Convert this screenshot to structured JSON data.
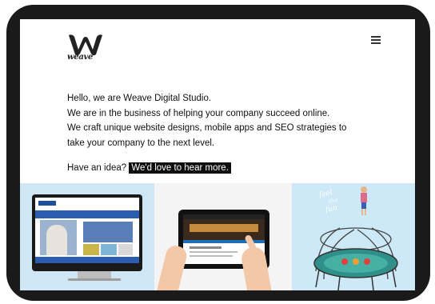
{
  "brand": {
    "name": "weave",
    "logo_icon": "weave-w-logo",
    "accent": "#1a1a1a"
  },
  "header": {
    "menu_icon": "hamburger-icon"
  },
  "intro": {
    "line1": "Hello, we are Weave Digital Studio.",
    "line2": "We are in the business of helping your company succeed online.",
    "line3": "We craft unique website designs, mobile apps and SEO strategies to",
    "line4": "take your company to the next level."
  },
  "cta": {
    "question": "Have an idea?",
    "link": "We'd love to hear more."
  },
  "portfolio": {
    "panel1_alt": "website on desktop monitor",
    "panel2_alt": "website on tablet held in hands",
    "panel3_text1": "feel",
    "panel3_text2": "the",
    "panel3_text3": "fun"
  },
  "colors": {
    "panel_blue": "#cfe7f5",
    "panel_grey": "#f4f4f4",
    "highlight_bg": "#0d0d0d"
  }
}
